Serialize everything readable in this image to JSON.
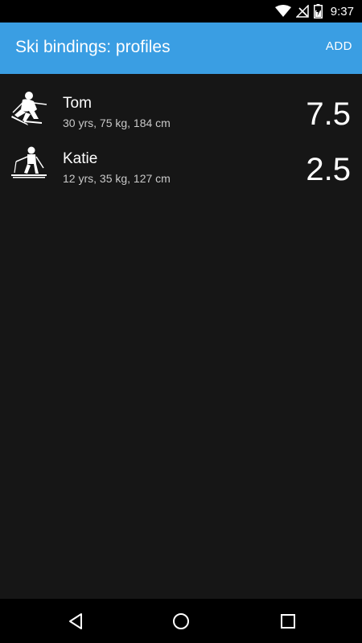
{
  "status_bar": {
    "time": "9:37",
    "icons": [
      "wifi-icon",
      "no-signal-icon",
      "battery-icon"
    ]
  },
  "app_bar": {
    "title": "Ski bindings: profiles",
    "action_label": "ADD",
    "color": "#3a9ee3"
  },
  "profiles": [
    {
      "name": "Tom",
      "details": "30 yrs, 75 kg, 184 cm",
      "din": "7.5",
      "icon": "advanced-skier-icon"
    },
    {
      "name": "Katie",
      "details": "12 yrs, 35 kg, 127 cm",
      "din": "2.5",
      "icon": "beginner-skier-icon"
    }
  ],
  "nav_bar": {
    "buttons": [
      "back-icon",
      "home-icon",
      "recents-icon"
    ]
  }
}
